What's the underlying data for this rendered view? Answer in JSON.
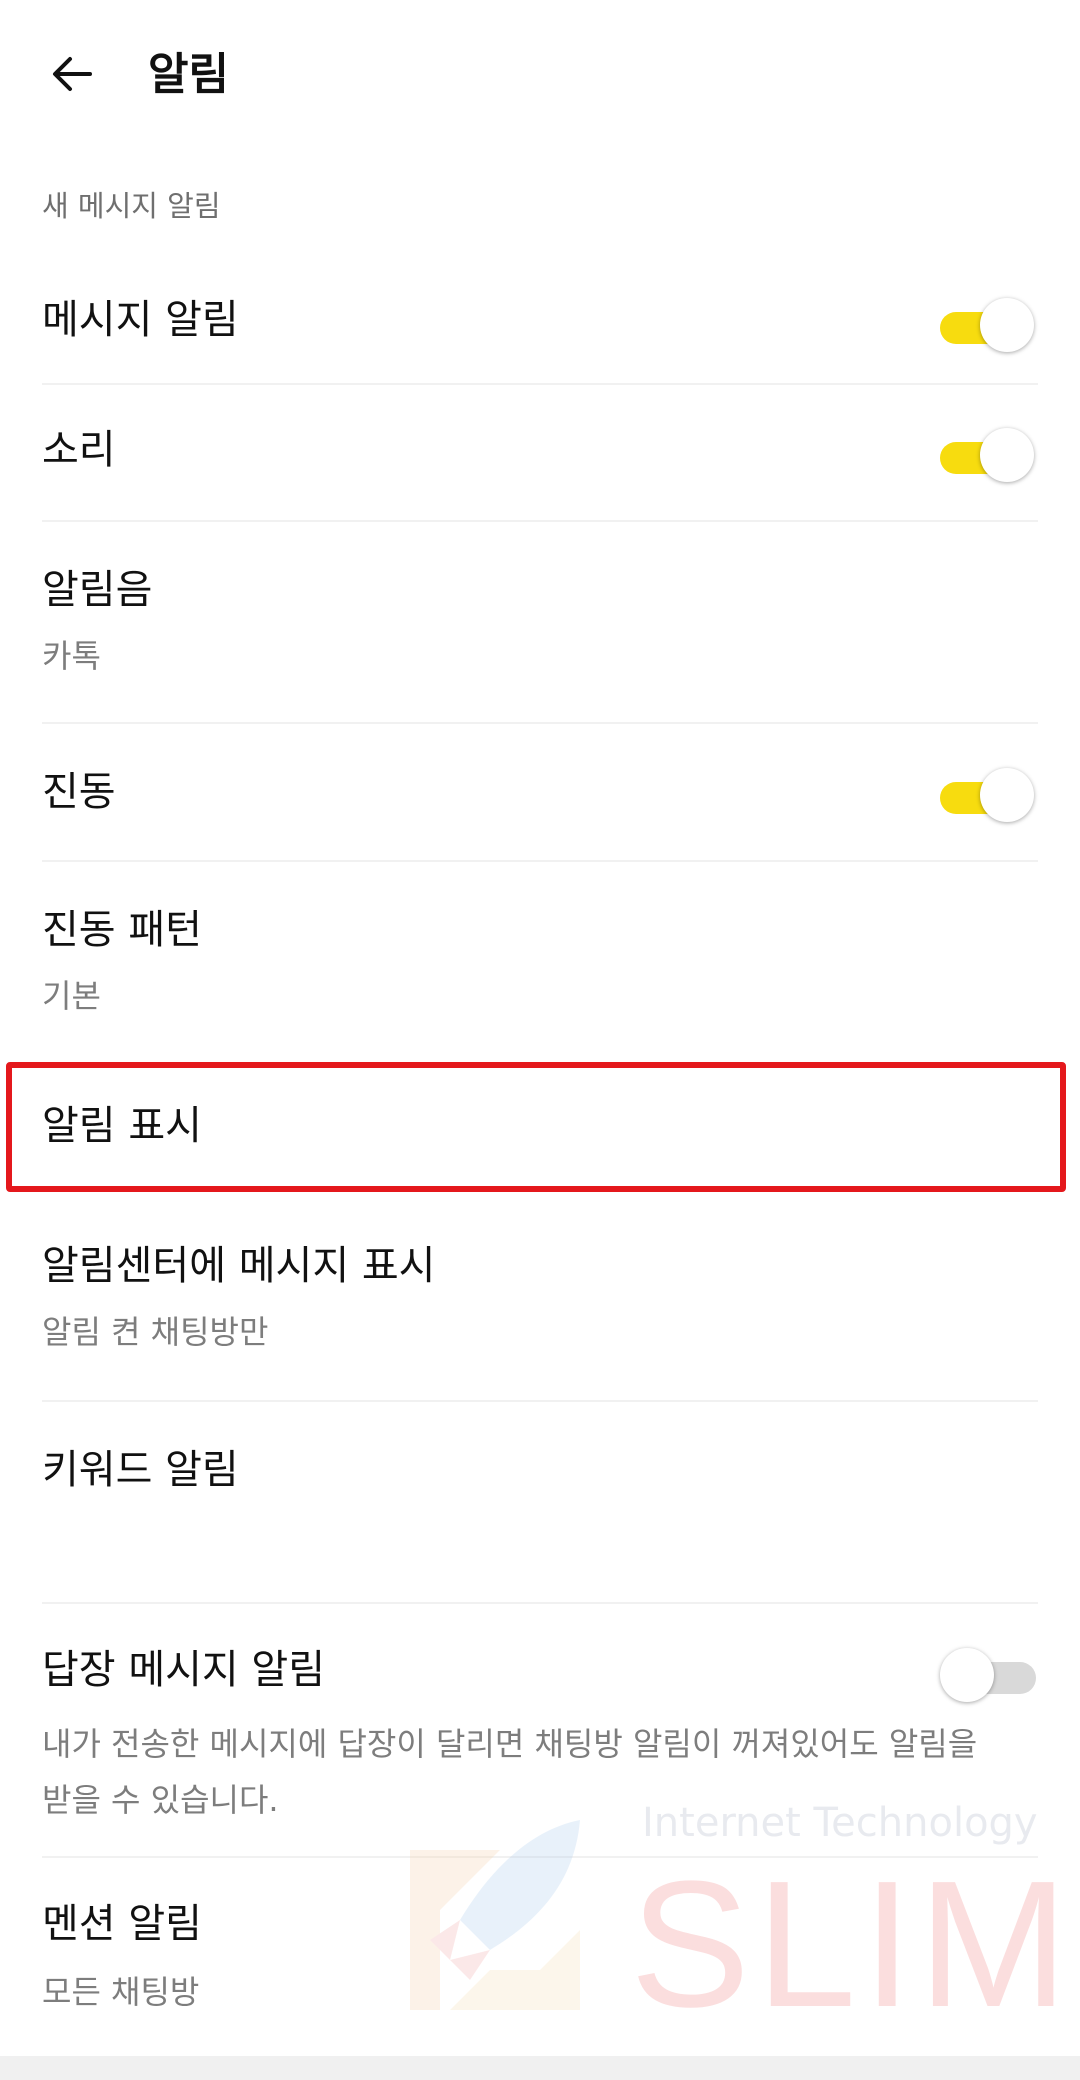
{
  "header": {
    "title": "알림"
  },
  "section": {
    "label": "새 메시지 알림"
  },
  "rows": {
    "message_alert": {
      "title": "메시지 알림",
      "enabled": true
    },
    "sound": {
      "title": "소리",
      "enabled": true
    },
    "ringtone": {
      "title": "알림음",
      "value": "카톡"
    },
    "vibration": {
      "title": "진동",
      "enabled": true
    },
    "vibration_pattern": {
      "title": "진동 패턴",
      "value": "기본"
    },
    "notification_display": {
      "title": "알림 표시"
    },
    "notification_center": {
      "title": "알림센터에 메시지 표시",
      "value": "알림 켠 채팅방만"
    },
    "keyword_alert": {
      "title": "키워드 알림"
    },
    "reply_alert": {
      "title": "답장 메시지 알림",
      "description": "내가 전송한 메시지에 답장이 달리면 채팅방 알림이 꺼져있어도 알림을 받을 수 있습니다.",
      "enabled": false
    },
    "mention_alert": {
      "title": "멘션 알림",
      "value": "모든 채팅방"
    }
  },
  "watermark": {
    "tagline": "Internet Technology",
    "logo": "SLIM"
  },
  "colors": {
    "toggle_on": "#f7dc0f",
    "toggle_off": "#d9d9d9",
    "highlight": "#e4181c"
  }
}
